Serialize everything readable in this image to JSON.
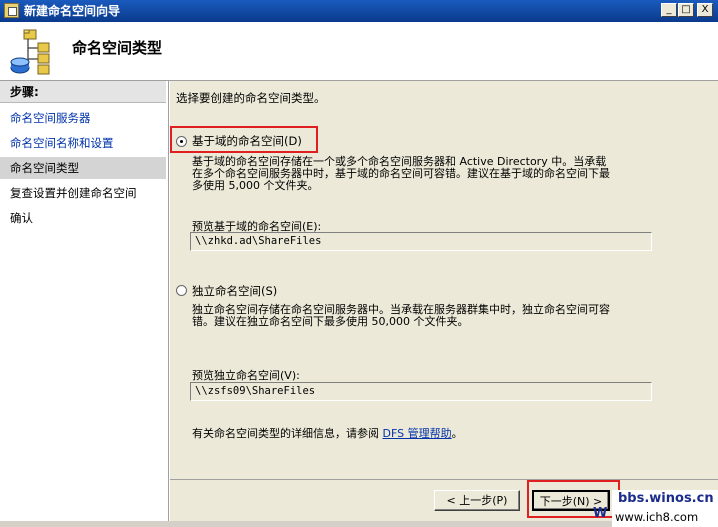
{
  "window": {
    "title": "新建命名空间向导",
    "controls": {
      "minimize": "_",
      "maximize": "□",
      "close": "X"
    }
  },
  "header": {
    "page_title": "命名空间类型",
    "icon": "namespace-wizard-icon"
  },
  "steps": {
    "header": "步骤:",
    "items": [
      {
        "label": "命名空间服务器",
        "state": "link"
      },
      {
        "label": "命名空间名称和设置",
        "state": "link"
      },
      {
        "label": "命名空间类型",
        "state": "current"
      },
      {
        "label": "复查设置并创建命名空间",
        "state": "plain"
      },
      {
        "label": "确认",
        "state": "plain"
      }
    ]
  },
  "main": {
    "instruction": "选择要创建的命名空间类型。",
    "domain_option": {
      "label": "基于域的命名空间(D)",
      "selected": true,
      "description_lines": [
        "基于域的命名空间存储在一个或多个命名空间服务器和 Active Directory 中。当承载",
        "在多个命名空间服务器中时，基于域的命名空间可容错。建议在基于域的命名空间下最",
        "多使用 5,000 个文件夹。"
      ],
      "preview_label": "预览基于域的命名空间(E):",
      "preview_value": "\\\\zhkd.ad\\ShareFiles"
    },
    "standalone_option": {
      "label": "独立命名空间(S)",
      "selected": false,
      "description_lines": [
        "独立命名空间存储在命名空间服务器中。当承载在服务器群集中时，独立命名空间可容",
        "错。建议在独立命名空间下最多使用 50,000 个文件夹。"
      ],
      "preview_label": "预览独立命名空间(V):",
      "preview_value": "\\\\zsfs09\\ShareFiles"
    },
    "help_text": "有关命名空间类型的详细信息，请参阅",
    "help_link": "DFS 管理帮助",
    "help_end": "。"
  },
  "buttons": {
    "back": "< 上一步(P)",
    "next": "下一步(N) >"
  },
  "watermark": {
    "line1": "bbs.winos.cn",
    "line2_w": "W",
    "line3": "www.ich8.com"
  },
  "colors": {
    "highlight": "#e02020",
    "link": "#0033aa",
    "title_bar": "#0a3a8c"
  }
}
